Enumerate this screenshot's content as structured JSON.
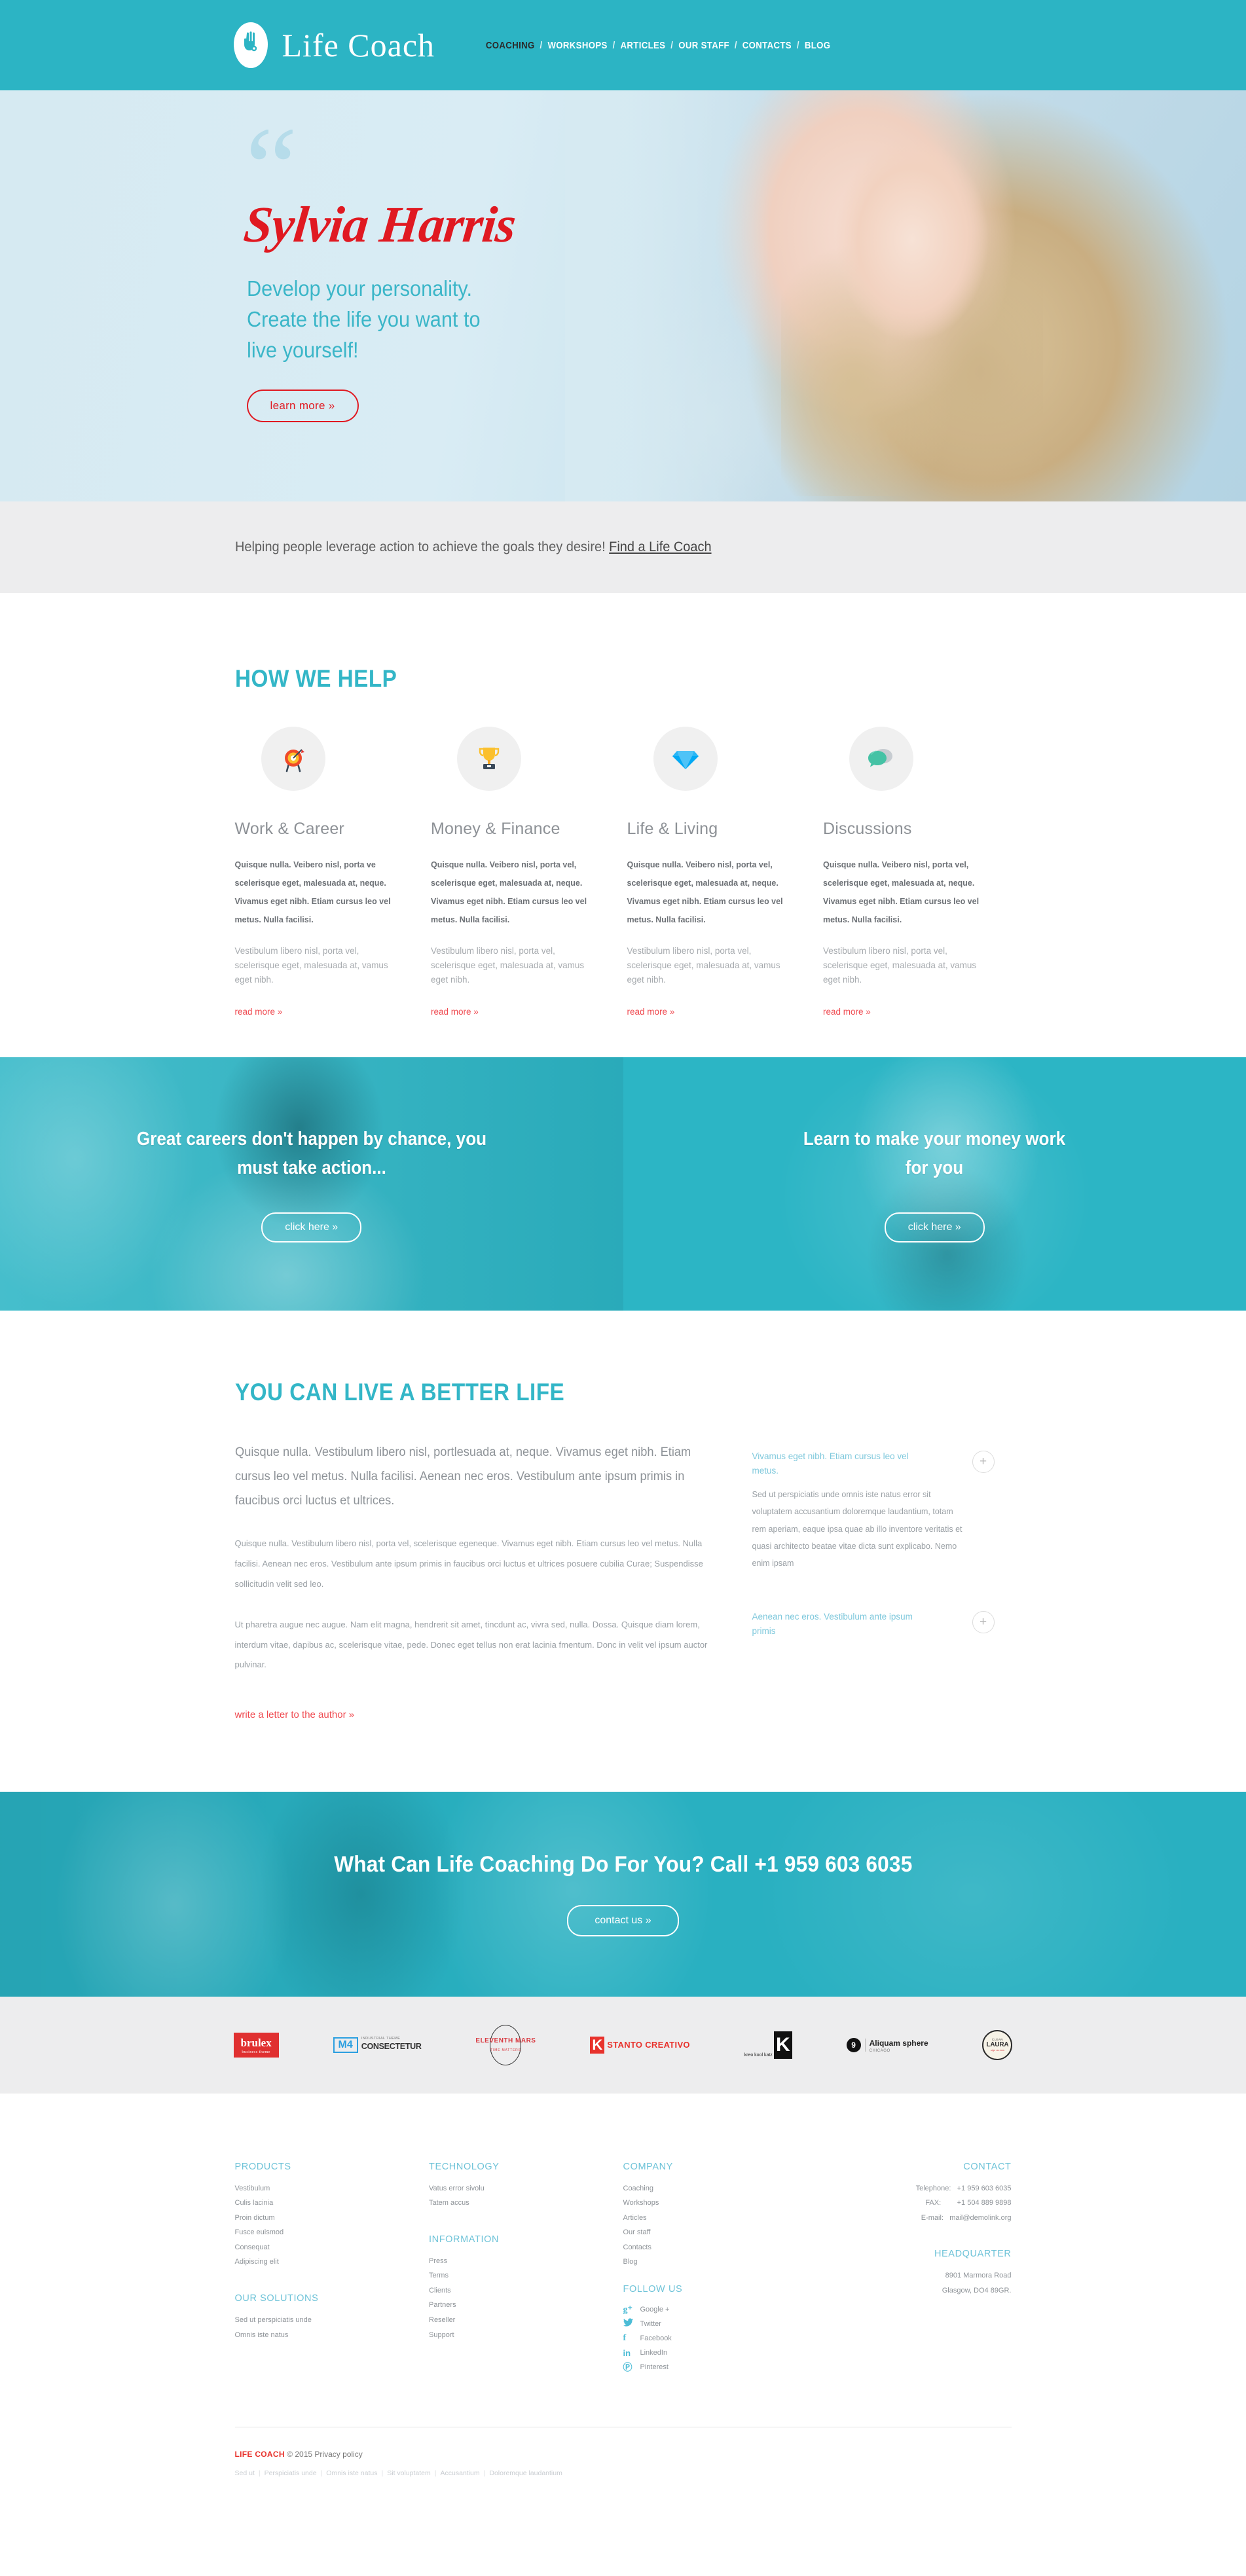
{
  "brand": {
    "logo_text": "Life Coach",
    "logo_icon": "coach-leaf-hand-icon",
    "accent_teal": "#2cb4c4",
    "accent_red": "#e01921",
    "link_red": "#ef4a50",
    "footer_heading_blue": "#6ec3d8"
  },
  "nav": {
    "items": [
      {
        "label": "COACHING",
        "active": true
      },
      {
        "label": "WORKSHOPS",
        "active": false
      },
      {
        "label": "ARTICLES",
        "active": false
      },
      {
        "label": "OUR STAFF",
        "active": false
      },
      {
        "label": "CONTACTS",
        "active": false
      },
      {
        "label": "BLOG",
        "active": false
      }
    ],
    "separator": "/"
  },
  "hero": {
    "quote_glyph": "“",
    "name": "Sylvia Harris",
    "sub_line1": "Develop your personality.",
    "sub_line2": "Create the life you want to",
    "sub_line3": "live yourself!",
    "cta_label": "learn more  »"
  },
  "tagline": {
    "text": "Helping people leverage action to achieve the goals they desire! ",
    "link": "Find a Life Coach"
  },
  "how_we_help": {
    "title": "HOW WE HELP",
    "read_more_label": "read more  »",
    "cards": [
      {
        "icon": "target-dartboard-icon",
        "title": "Work & Career",
        "body_bold": "Quisque nulla. Veibero nisl, porta ve scelerisque eget, malesuada at, neque. Vivamus eget nibh. Etiam cursus leo vel metus. Nulla facilisi.",
        "body_light": "Vestibulum libero nisl, porta vel, scelerisque eget, malesuada at, vamus eget nibh."
      },
      {
        "icon": "trophy-icon",
        "title": "Money & Finance",
        "body_bold": "Quisque nulla. Veibero nisl, porta vel, scelerisque eget, malesuada at, neque. Vivamus eget nibh. Etiam cursus leo vel metus. Nulla facilisi.",
        "body_light": "Vestibulum libero nisl, porta vel, scelerisque eget, malesuada at, vamus eget nibh."
      },
      {
        "icon": "diamond-gem-icon",
        "title": "Life & Living",
        "body_bold": "Quisque nulla. Veibero nisl, porta vel, scelerisque eget, malesuada at, neque. Vivamus eget nibh. Etiam cursus leo vel metus. Nulla facilisi.",
        "body_light": "Vestibulum libero nisl, porta vel, scelerisque eget, malesuada at, vamus eget nibh."
      },
      {
        "icon": "chat-bubbles-icon",
        "title": "Discussions",
        "body_bold": "Quisque nulla. Veibero nisl, porta vel, scelerisque eget, malesuada at, neque. Vivamus eget nibh. Etiam cursus leo vel metus. Nulla facilisi.",
        "body_light": "Vestibulum libero nisl, porta vel, scelerisque eget, malesuada at, vamus eget nibh."
      }
    ]
  },
  "banners": [
    {
      "text": "Great careers don't happen by chance, you must take action...",
      "button": "click here »",
      "photo": "man-with-glasses-photo"
    },
    {
      "text": "Learn to make your money work for you",
      "button": "click here »",
      "photo": "piggy-bank-in-hands-photo"
    }
  ],
  "better_life": {
    "title": "YOU CAN LIVE A BETTER LIFE",
    "lead": "Quisque nulla. Vestibulum libero nisl, portlesuada at, neque. Vivamus eget nibh. Etiam cursus leo vel metus. Nulla facilisi. Aenean nec eros. Vestibulum ante ipsum primis in faucibus orci luctus et ultrices.",
    "para2": "Quisque nulla. Vestibulum libero nisl, porta vel, scelerisque egeneque. Vivamus eget nibh. Etiam cursus leo vel metus. Nulla facilisi. Aenean nec eros. Vestibulum ante ipsum primis in faucibus orci luctus et ultrices posuere cubilia Curae; Suspendisse sollicitudin velit sed leo.",
    "para3": "Ut pharetra augue nec augue. Nam elit magna, hendrerit sit amet, tincdunt ac, vivra sed, nulla. Dossa. Quisque diam lorem, interdum vitae, dapibus ac, scelerisque vitae, pede. Donec eget tellus non erat lacinia fmentum. Donc in velit vel ipsum auctor pulvinar.",
    "link": "write a letter to the author  »",
    "accordion": [
      {
        "title": "Vivamus eget nibh. Etiam cursus leo vel metus.",
        "toggle": "+",
        "body": "Sed ut perspiciatis unde omnis iste natus error sit voluptatem accusantium doloremque laudantium, totam rem aperiam, eaque ipsa quae ab illo inventore veritatis et quasi architecto beatae vitae dicta sunt explicabo. Nemo enim ipsam"
      },
      {
        "title": "Aenean nec eros. Vestibulum ante ipsum primis",
        "toggle": "+",
        "body": ""
      }
    ]
  },
  "cta": {
    "title": "What Can Life Coaching Do For You? Call +1 959 603 6035",
    "button": "contact us »"
  },
  "partners": [
    {
      "name": "brulex",
      "tagline": "business theme"
    },
    {
      "name": "M4",
      "sub_small": "INDUSTRIAL THEME",
      "sub_big": "CONSECTETUR"
    },
    {
      "name": "ELEVENTH MARS",
      "tagline": "TIME MATTERS"
    },
    {
      "name": "STANTO CREATIVO",
      "mark": "K"
    },
    {
      "name": "kreo kool katz",
      "mark": "K"
    },
    {
      "name": "Aliquam sphere",
      "tagline": "CHICAGO"
    },
    {
      "name": "CLEAN LAURA",
      "tagline": "sign us now"
    }
  ],
  "footer": {
    "columns": [
      {
        "sections": [
          {
            "heading": "PRODUCTS",
            "links": [
              "Vestibulum",
              "Culis lacinia",
              "Proin dictum",
              "Fusce euismod",
              "Consequat",
              "Adipiscing elit"
            ]
          },
          {
            "heading": "OUR SOLUTIONS",
            "links": [
              "Sed ut perspiciatis unde",
              "Omnis iste natus"
            ]
          }
        ]
      },
      {
        "sections": [
          {
            "heading": "TECHNOLOGY",
            "links": [
              "Vatus error sivolu",
              "Tatem accus"
            ]
          },
          {
            "heading": "INFORMATION",
            "links": [
              "Press",
              "Terms",
              "Clients",
              "Partners",
              "Reseller",
              "Support"
            ]
          }
        ]
      },
      {
        "sections": [
          {
            "heading": "COMPANY",
            "links": [
              "Coaching",
              "Workshops",
              "Articles",
              "Our staff",
              "Contacts",
              "Blog"
            ]
          }
        ],
        "follow_heading": "FOLLOW US",
        "social": [
          {
            "icon": "google-plus-icon",
            "glyph": "g⁺",
            "label": "Google +"
          },
          {
            "icon": "twitter-icon",
            "glyph": "ᵤ",
            "label": "Twitter"
          },
          {
            "icon": "facebook-icon",
            "glyph": "f",
            "label": "Facebook"
          },
          {
            "icon": "linkedin-icon",
            "glyph": "in",
            "label": "LinkedIn"
          },
          {
            "icon": "pinterest-icon",
            "glyph": "Ⓟ",
            "label": "Pinterest"
          }
        ]
      },
      {
        "contact_heading": "CONTACT",
        "contact_rows": [
          {
            "key": "Telephone:",
            "value": "+1 959 603 6035"
          },
          {
            "key": "FAX:",
            "value": "+1 504 889 9898"
          },
          {
            "key": "E-mail:",
            "value": "mail@demolink.org"
          }
        ],
        "hq_heading": "HEADQUARTER",
        "hq_lines": [
          "8901 Marmora Road",
          "Glasgow, DO4 89GR."
        ]
      }
    ],
    "copyright_brand": "LIFE COACH",
    "copyright_text": "© 2015 ",
    "privacy_label": "Privacy policy",
    "bottom_links": [
      "Sed ut",
      "Perspiciatis unde",
      "Omnis iste natus",
      "Sit voluptatem",
      "Accusantium",
      "Doloremque laudantium"
    ]
  }
}
